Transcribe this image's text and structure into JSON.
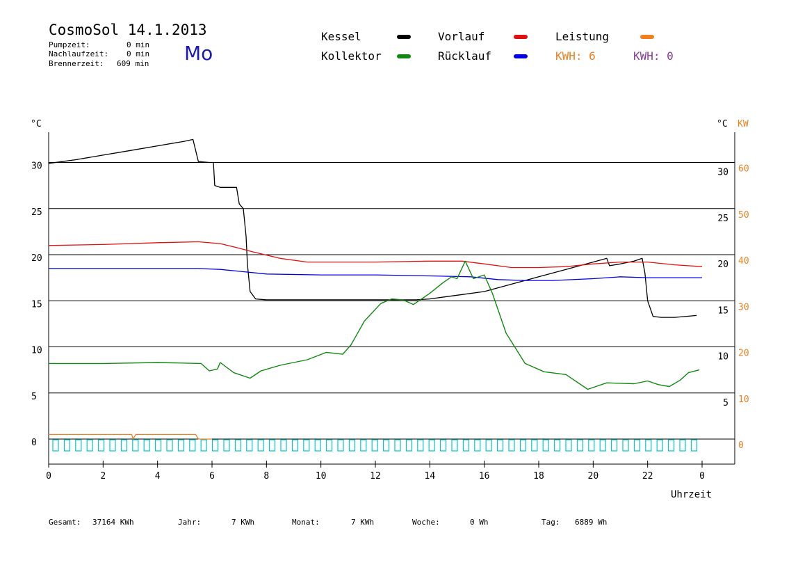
{
  "header": {
    "title": "CosmoSol 14.1.2013",
    "pumpzeit_label": "Pumpzeit:",
    "pumpzeit_value": "0 min",
    "nachlaufzeit_label": "Nachlaufzeit:",
    "nachlaufzeit_value": "0 min",
    "brennerzeit_label": "Brennerzeit:",
    "brennerzeit_value": "609 min",
    "day": "Mo"
  },
  "legend": {
    "kessel": "Kessel",
    "vorlauf": "Vorlauf",
    "leistung": "Leistung",
    "kollektor": "Kollektor",
    "ruecklauf": "Rücklauf",
    "kwh1": "KWH: 6",
    "kwh2": "KWH: 0"
  },
  "colors": {
    "kessel": "#000000",
    "vorlauf": "#e01010",
    "ruecklauf": "#0000e0",
    "kollektor": "#118811",
    "leistung": "#f08020",
    "kwh2": "#8a3a9a",
    "pump": "#00c8c8"
  },
  "footer": {
    "gesamt_label": "Gesamt:",
    "gesamt_value": "37164 KWh",
    "jahr_label": "Jahr:",
    "jahr_value": "7 KWh",
    "monat_label": "Monat:",
    "monat_value": "7 KWh",
    "woche_label": "Woche:",
    "woche_value": "0 Wh",
    "tag_label": "Tag:",
    "tag_value": "6889 Wh"
  },
  "chart_data": {
    "type": "line",
    "xlabel": "Uhrzeit",
    "ylabel_left": "°C",
    "ylabel_right_temp": "°C",
    "ylabel_right_power": "KW",
    "x_ticks": [
      "0",
      "2",
      "4",
      "6",
      "8",
      "10",
      "12",
      "14",
      "16",
      "18",
      "20",
      "22",
      "0"
    ],
    "y_ticks_left": [
      "0",
      "5",
      "10",
      "15",
      "20",
      "25",
      "30"
    ],
    "y_ticks_right_temp": [
      "5",
      "10",
      "15",
      "20",
      "25",
      "30"
    ],
    "y_ticks_right_power": [
      "0",
      "10",
      "20",
      "30",
      "40",
      "50",
      "60"
    ],
    "xlim": [
      0,
      24
    ],
    "ylim": [
      0,
      33
    ],
    "grid": "horizontal",
    "series": [
      {
        "name": "Kessel",
        "color": "#000000",
        "x": [
          0,
          0.5,
          1,
          2,
          3,
          4,
          5,
          5.3,
          5.5,
          5.9,
          6.05,
          6.1,
          6.3,
          6.9,
          7.0,
          7.15,
          7.25,
          7.3,
          7.4,
          7.6,
          8,
          10,
          12,
          13.5,
          14,
          15,
          16,
          17,
          18,
          19,
          20,
          20.5,
          20.6,
          21,
          21.5,
          21.8,
          21.9,
          22.0,
          22.2,
          22.5,
          23,
          23.8
        ],
        "y": [
          29.9,
          30.1,
          30.3,
          30.8,
          31.3,
          31.8,
          32.3,
          32.5,
          30.1,
          30.0,
          30.0,
          27.5,
          27.3,
          27.3,
          25.5,
          25.0,
          22,
          19,
          16,
          15.2,
          15.1,
          15.1,
          15.1,
          15.1,
          15.2,
          15.6,
          16.0,
          16.8,
          17.6,
          18.4,
          19.2,
          19.6,
          18.8,
          19.0,
          19.3,
          19.6,
          18.0,
          15.0,
          13.3,
          13.2,
          13.2,
          13.4
        ]
      },
      {
        "name": "Vorlauf",
        "color": "#e01010",
        "x": [
          0,
          2,
          4,
          5.5,
          6.3,
          7.0,
          7.5,
          8.5,
          9.5,
          12,
          14,
          15.2,
          16,
          17,
          18,
          19,
          20,
          21,
          22,
          23,
          24
        ],
        "y": [
          21.0,
          21.1,
          21.3,
          21.4,
          21.2,
          20.7,
          20.3,
          19.6,
          19.2,
          19.2,
          19.3,
          19.3,
          19.0,
          18.6,
          18.6,
          18.7,
          19.0,
          19.2,
          19.2,
          18.9,
          18.7
        ]
      },
      {
        "name": "Rücklauf",
        "color": "#0000e0",
        "x": [
          0,
          2,
          4,
          5.5,
          6.3,
          7.0,
          8,
          10,
          12,
          14,
          15.5,
          16.5,
          17.5,
          18.5,
          20,
          21,
          22,
          24
        ],
        "y": [
          18.5,
          18.5,
          18.5,
          18.5,
          18.4,
          18.2,
          17.9,
          17.8,
          17.8,
          17.7,
          17.6,
          17.3,
          17.2,
          17.2,
          17.4,
          17.6,
          17.5,
          17.5
        ]
      },
      {
        "name": "Kollektor",
        "color": "#118811",
        "x": [
          0,
          2,
          4,
          5.6,
          5.9,
          6.2,
          6.3,
          6.8,
          7.4,
          7.8,
          8.5,
          9.5,
          10.2,
          10.8,
          11.1,
          11.6,
          12.2,
          12.6,
          13.0,
          13.4,
          14,
          14.5,
          14.8,
          15.0,
          15.3,
          15.6,
          16.0,
          16.3,
          16.8,
          17.5,
          18.2,
          19.0,
          19.8,
          20.5,
          21.5,
          22.0,
          22.4,
          22.8,
          23.2,
          23.5,
          23.9
        ],
        "y": [
          8.2,
          8.2,
          8.3,
          8.2,
          7.4,
          7.6,
          8.3,
          7.2,
          6.6,
          7.4,
          8.0,
          8.6,
          9.4,
          9.2,
          10.2,
          12.8,
          14.7,
          15.2,
          15.1,
          14.6,
          15.8,
          17.0,
          17.6,
          17.4,
          19.3,
          17.4,
          17.8,
          15.8,
          11.5,
          8.2,
          7.3,
          7.0,
          5.4,
          6.1,
          6.0,
          6.3,
          5.9,
          5.7,
          6.4,
          7.2,
          7.5
        ]
      },
      {
        "name": "Leistung",
        "color": "#f08020",
        "x": [
          0,
          3.05,
          3.1,
          3.2,
          5.4,
          5.5,
          6.0
        ],
        "y": [
          0.5,
          0.5,
          0,
          0.5,
          0.5,
          0,
          0
        ]
      }
    ]
  }
}
